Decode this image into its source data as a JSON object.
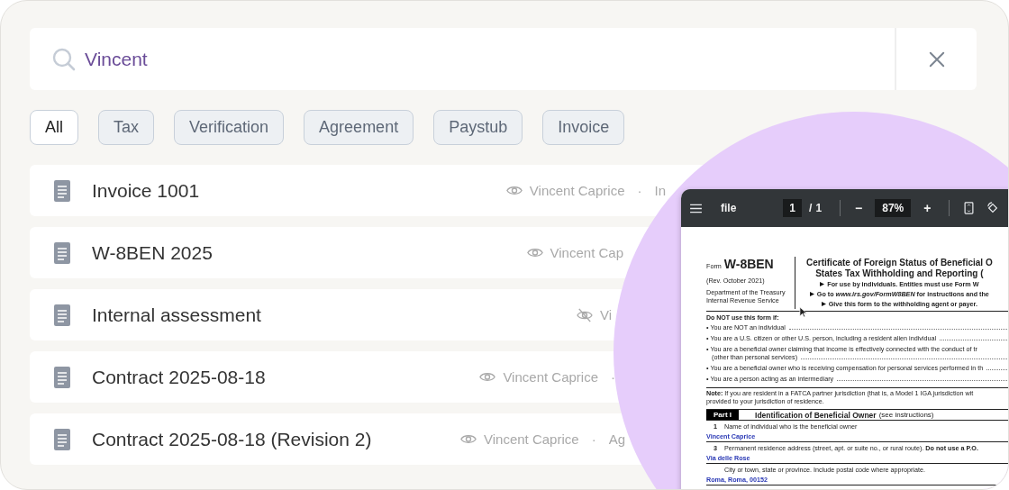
{
  "search": {
    "value": "Vincent"
  },
  "filters": [
    {
      "label": "All",
      "selected": true
    },
    {
      "label": "Tax",
      "selected": false
    },
    {
      "label": "Verification",
      "selected": false
    },
    {
      "label": "Agreement",
      "selected": false
    },
    {
      "label": "Paystub",
      "selected": false
    },
    {
      "label": "Invoice",
      "selected": false
    }
  ],
  "documents": [
    {
      "title": "Invoice 1001",
      "visible": true,
      "owner": "Vincent Caprice",
      "separator": "·",
      "tag": "In"
    },
    {
      "title": "W-8BEN 2025",
      "visible": true,
      "owner": "Vincent Cap"
    },
    {
      "title": "Internal assessment",
      "visible": false,
      "owner": "Vi"
    },
    {
      "title": "Contract 2025-08-18",
      "visible": true,
      "owner": "Vincent Caprice",
      "separator": "·"
    },
    {
      "title": "Contract 2025-08-18 (Revision 2)",
      "visible": true,
      "owner": "Vincent Caprice",
      "separator": "·",
      "tag": "Ag"
    }
  ],
  "viewer": {
    "title": "file",
    "page": "1",
    "page_separator": "/",
    "page_count": "1",
    "zoom_out": "−",
    "zoom": "87%",
    "zoom_in": "+",
    "form": {
      "form_label": "Form",
      "form_number": "W-8BEN",
      "revision": "(Rev. October 2021)",
      "department": [
        "Department of the Treasury",
        "Internal Revenue Service"
      ],
      "title_lines": [
        "Certificate of Foreign Status of Beneficial O",
        "States Tax Withholding and Reporting ("
      ],
      "instructions": [
        "For use by individuals. Entities must use Form W",
        "Go to *www.irs.gov/FormW8BEN* for instructions and the",
        "Give this form to the withholding agent or payer."
      ],
      "warning_heading": "Do NOT use this form if:",
      "conditions": [
        {
          "text": "• You are NOT an individual"
        },
        {
          "text": "• You are a U.S. citizen or other U.S. person, including a resident alien individual"
        },
        {
          "text": "• You are a beneficial owner claiming that income is effectively connected with the conduct of tr",
          "continuation": "(other than personal services)"
        },
        {
          "text": "• You are a beneficial owner who is receiving compensation for personal services performed in th"
        },
        {
          "text": "• You are a person acting as an intermediary"
        }
      ],
      "note": "**Note:** If you are resident in a FATCA partner jurisdiction (that is, a Model 1 IGA jurisdiction wit",
      "note_continuation": "provided to your jurisdiction of residence.",
      "part": {
        "label": "Part I",
        "title": "Identification of Beneficial Owner",
        "hint": "(see instructions)"
      },
      "fields": [
        {
          "number": "1",
          "label": "Name of individual who is the beneficial owner",
          "value": "Vincent Caprice"
        },
        {
          "number": "3",
          "label": "Permanent residence address (street, apt. or suite no., or rural route). **Do not use a P.O.**",
          "value": "Via delle Rose"
        },
        {
          "label": "City or town, state or province. Include postal code where appropriate.",
          "value": "Roma, Roma, 00152"
        }
      ]
    }
  }
}
